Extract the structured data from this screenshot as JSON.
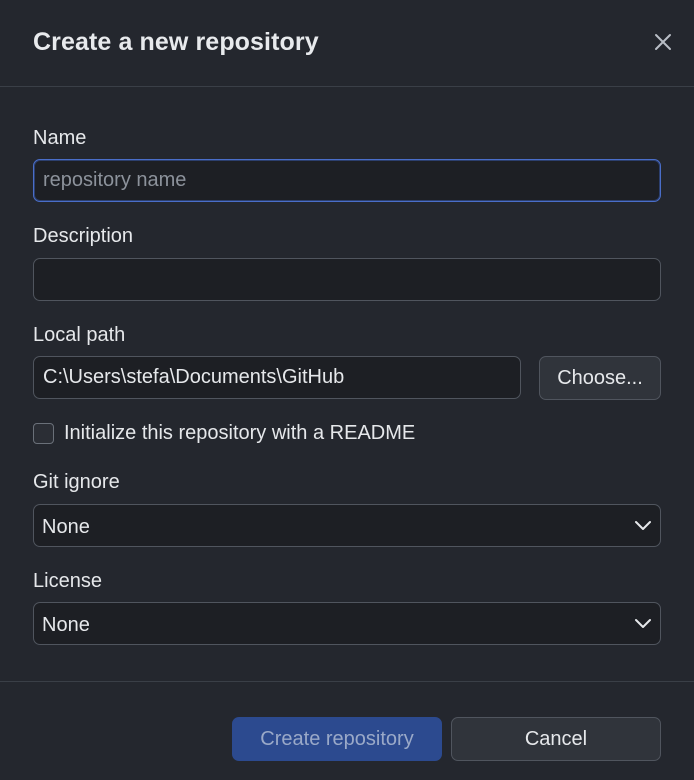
{
  "dialog": {
    "title": "Create a new repository",
    "close_icon": "close-icon"
  },
  "name": {
    "label": "Name",
    "value": "",
    "placeholder": "repository name"
  },
  "description": {
    "label": "Description",
    "value": "",
    "placeholder": ""
  },
  "local_path": {
    "label": "Local path",
    "value": "C:\\Users\\stefa\\Documents\\GitHub",
    "choose_label": "Choose..."
  },
  "readme": {
    "label": "Initialize this repository with a README",
    "checked": false
  },
  "git_ignore": {
    "label": "Git ignore",
    "selected": "None",
    "icon": "chevron-down-icon"
  },
  "license": {
    "label": "License",
    "selected": "None",
    "icon": "chevron-down-icon"
  },
  "actions": {
    "create_label": "Create repository",
    "cancel_label": "Cancel"
  },
  "colors": {
    "background": "#24272e",
    "field_background": "#1d1f24",
    "focus_border": "#4a6ec9",
    "primary_button": "#2c4a8f"
  }
}
